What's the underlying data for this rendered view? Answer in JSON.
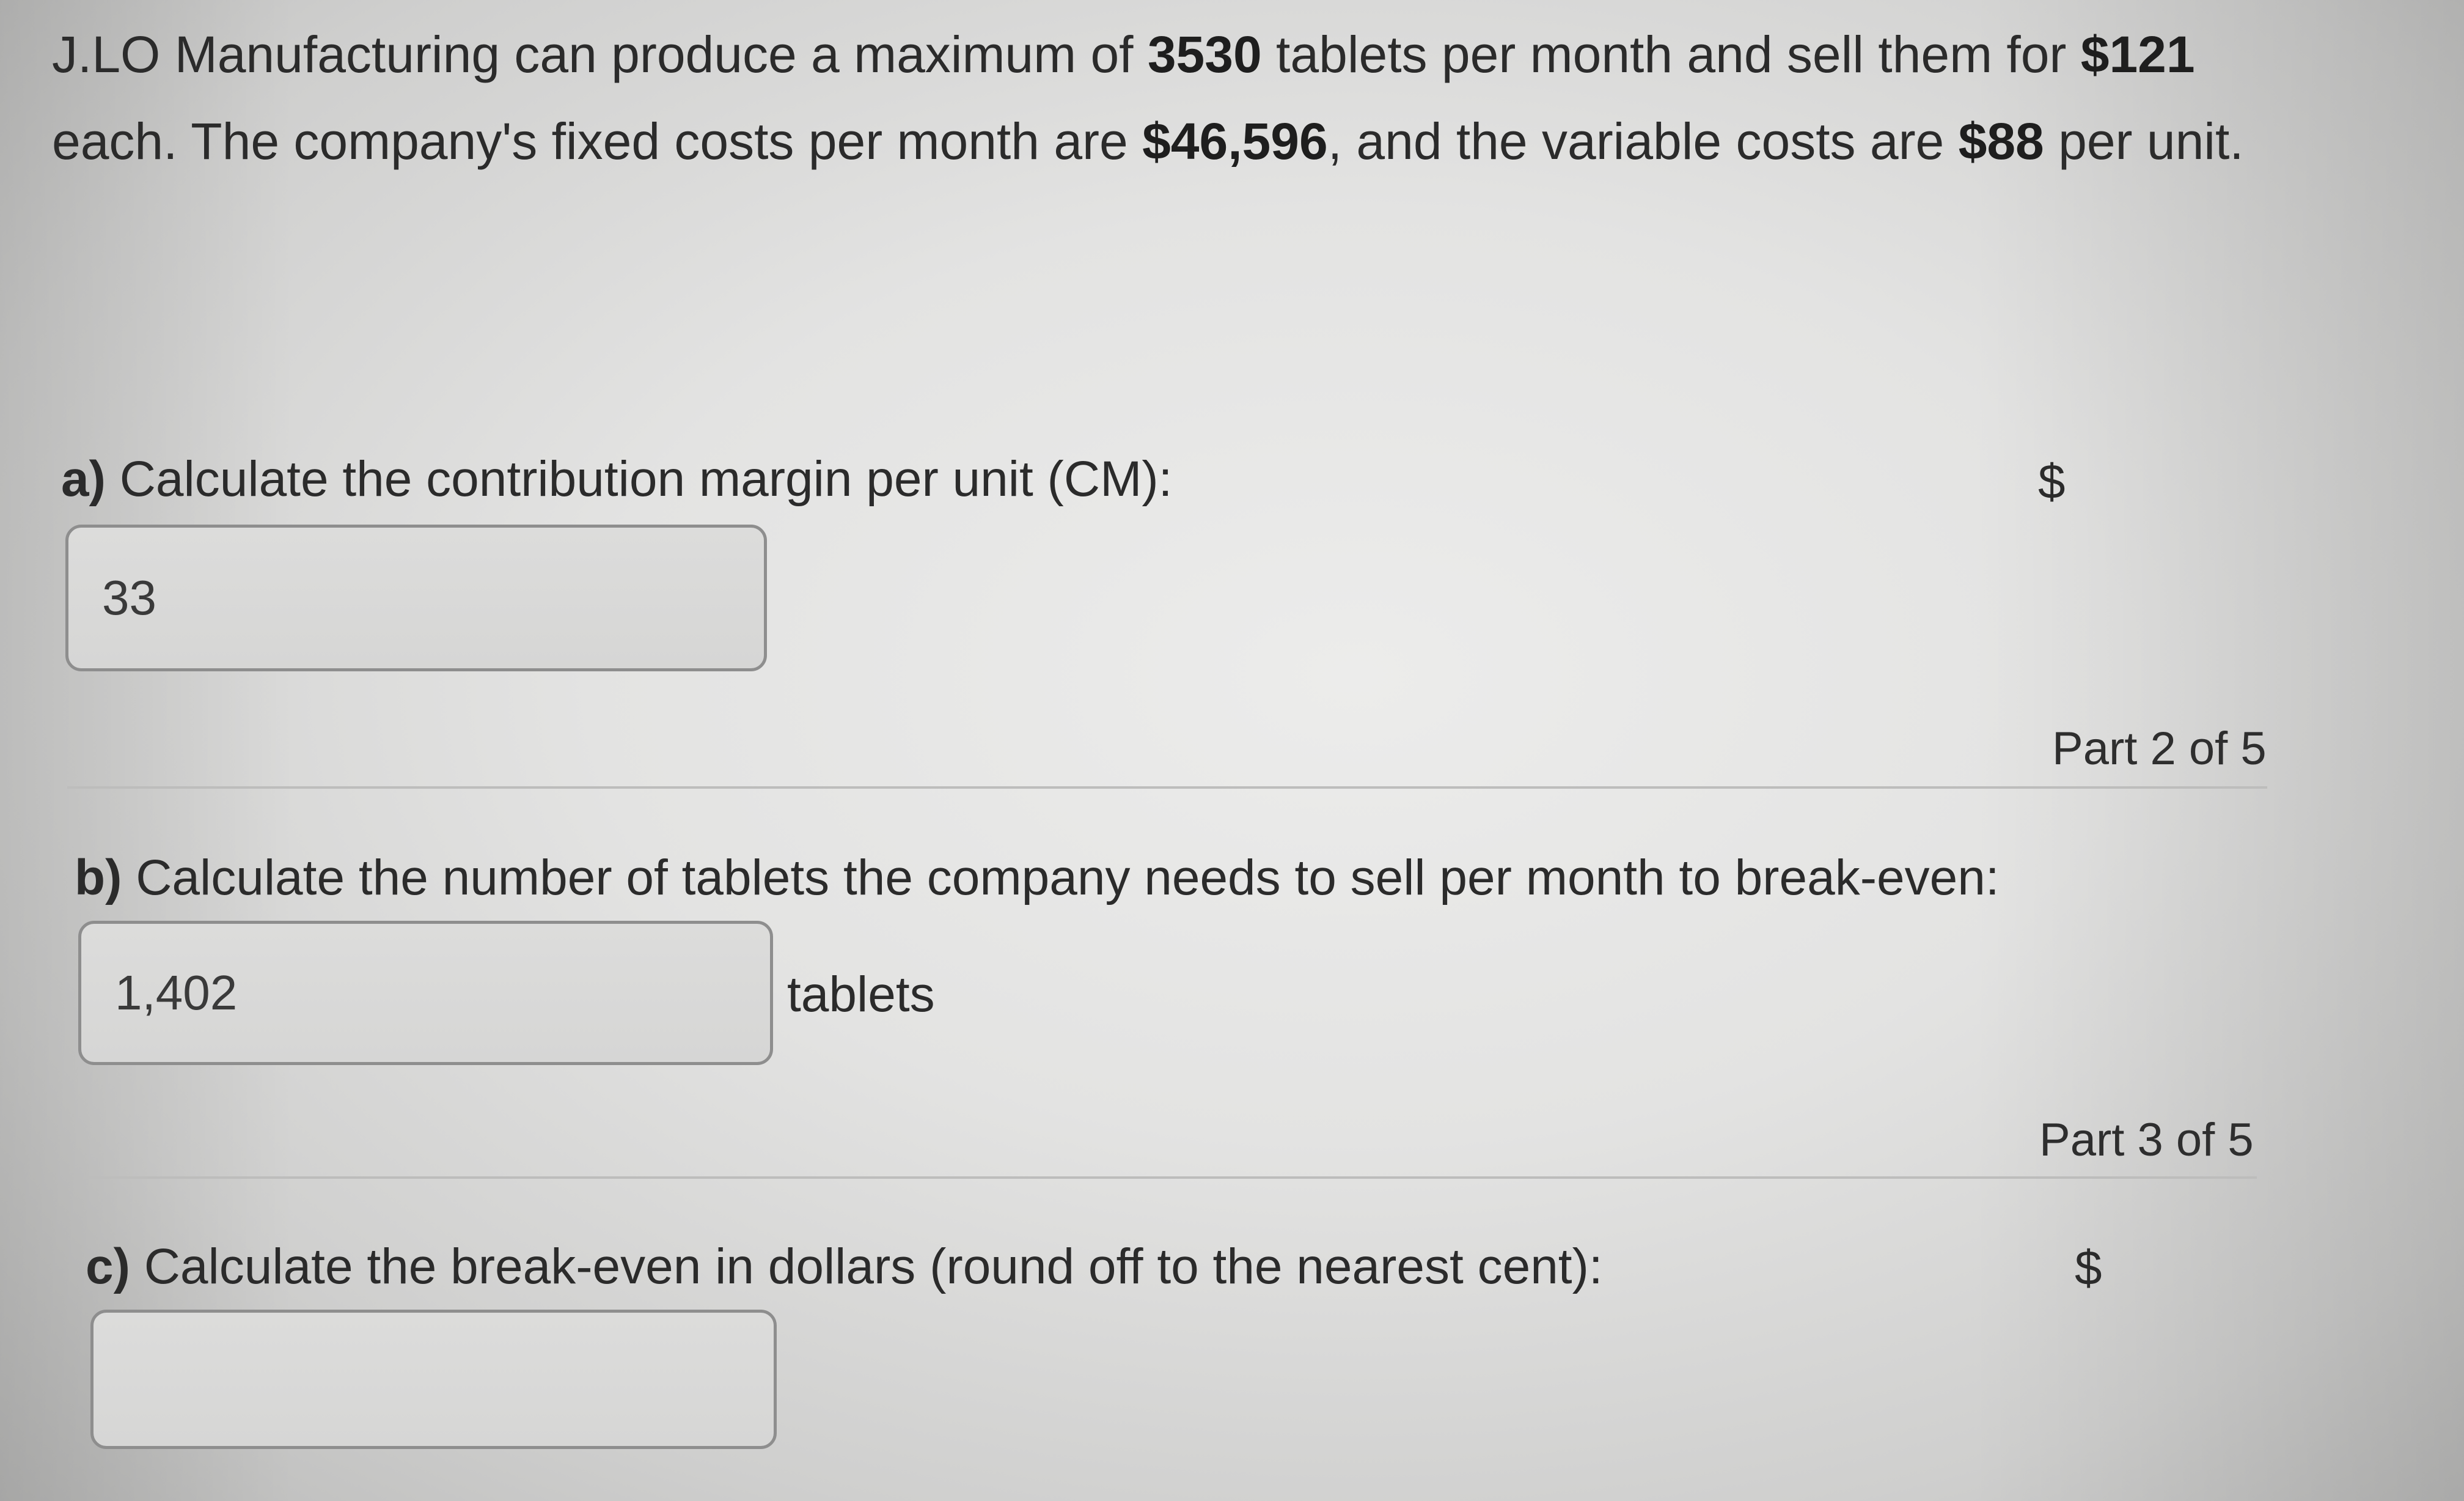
{
  "problem": {
    "p1": "J.LO Manufacturing can produce a maximum of ",
    "b1": "3530",
    "p2": " tablets per month and sell them for ",
    "b2": "$121",
    "p3": " each. The company's fixed costs per month are ",
    "b3": "$46,596",
    "p4": ", and the variable costs are ",
    "b4": "$88",
    "p5": " per unit."
  },
  "part_a": {
    "prefix": "a)",
    "question": " Calculate the contribution margin per unit (CM):",
    "currency_symbol": "$",
    "answer_value": "33"
  },
  "part_b": {
    "progress_label": "Part 2 of 5",
    "prefix": "b)",
    "question": " Calculate the number of tablets the company needs to sell per month to break-even:",
    "answer_value": "1,402",
    "unit_label": "tablets"
  },
  "part_c": {
    "progress_label": "Part 3 of 5",
    "prefix": "c)",
    "question": " Calculate the break-even in dollars (round off to the nearest cent):",
    "currency_symbol": "$",
    "answer_value": ""
  }
}
